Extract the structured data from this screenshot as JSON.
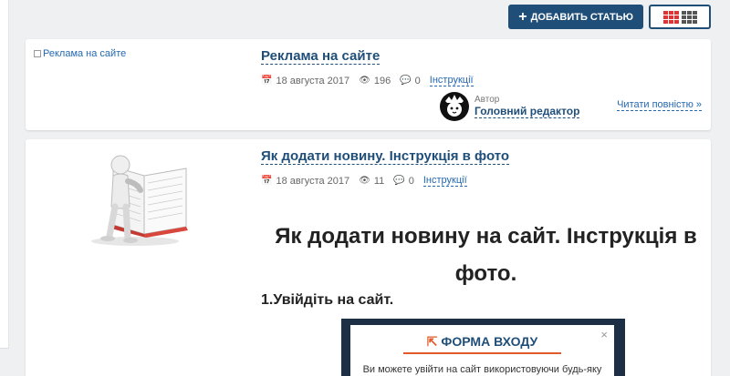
{
  "toolbar": {
    "add_article_label": "ДОБАВИТЬ СТАТЬЮ",
    "add_icon": "plus-icon",
    "view_icons": [
      "list-view-icon",
      "grid-view-icon"
    ],
    "accent_color": "#1f4e79",
    "toggle_color": "#e03434"
  },
  "posts": [
    {
      "image_alt": "Реклама на сайте",
      "title": "Реклама на сайте",
      "date": "18 августа 2017",
      "views": "196",
      "comments": "0",
      "category": "Інструкції",
      "author_role": "Автор",
      "author_name": "Головний редактор",
      "read_more": "Читати повністю »"
    },
    {
      "title": "Як додати новину. Інструкція в фото",
      "date": "18 августа 2017",
      "views": "11",
      "comments": "0",
      "category": "Інструкції",
      "excerpt_heading": "Як додати новину на сайт. Інструкція в фото.",
      "step_1": "1.Увійдіть на сайт.",
      "login_form_title": "ФОРМА ВХОДУ",
      "login_form_close": "×",
      "login_form_text": "Ви можете увійти на сайт використовуючи будь-яку"
    }
  ]
}
